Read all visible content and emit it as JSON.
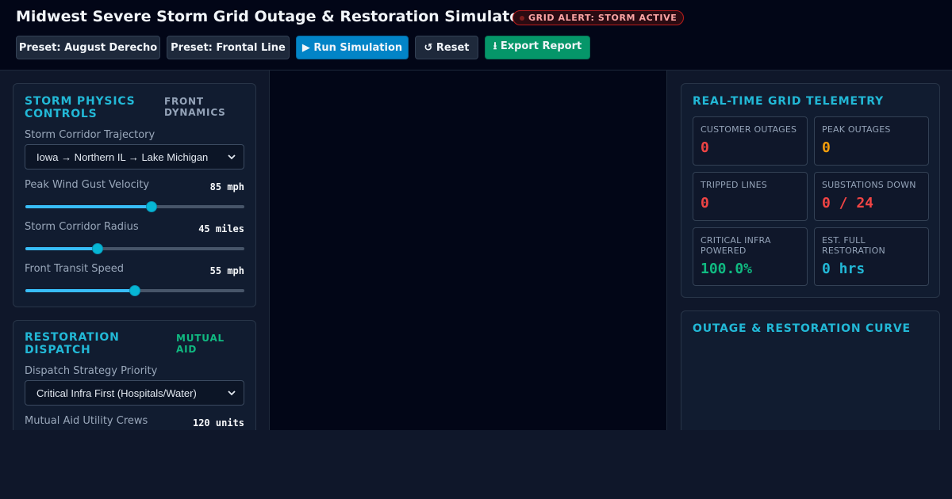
{
  "header": {
    "title": "Midwest Severe Storm Grid Outage & Restoration Simulator",
    "alert": "GRID ALERT: STORM ACTIVE",
    "buttons": {
      "preset_derecho": "Preset: August Derecho",
      "preset_frontal": "Preset: Frontal Line",
      "run": "▶ Run Simulation",
      "reset": "↺ Reset",
      "export": "⭳ Export Report"
    }
  },
  "storm_panel": {
    "title": "STORM PHYSICS CONTROLS",
    "tag": "FRONT DYNAMICS",
    "trajectory_label": "Storm Corridor Trajectory",
    "trajectory_value": "Iowa → Northern IL → Lake Michigan",
    "wind_label": "Peak Wind Gust Velocity",
    "wind_value": "85 mph",
    "wind_fraction": 0.58,
    "radius_label": "Storm Corridor Radius",
    "radius_value": "45 miles",
    "radius_fraction": 0.32,
    "speed_label": "Front Transit Speed",
    "speed_value": "55 mph",
    "speed_fraction": 0.5
  },
  "dispatch_panel": {
    "title": "RESTORATION DISPATCH",
    "tag": "MUTUAL AID",
    "strategy_label": "Dispatch Strategy Priority",
    "strategy_value": "Critical Infra First (Hospitals/Water)",
    "crews_label": "Mutual Aid Utility Crews",
    "crews_value": "120 units"
  },
  "telemetry": {
    "title": "REAL-TIME GRID TELEMETRY",
    "metrics": [
      {
        "label": "CUSTOMER OUTAGES",
        "value": "0",
        "color": "#ef4444"
      },
      {
        "label": "PEAK OUTAGES",
        "value": "0",
        "color": "#f59e0b"
      },
      {
        "label": "TRIPPED LINES",
        "value": "0",
        "color": "#ef4444"
      },
      {
        "label": "SUBSTATIONS DOWN",
        "value": "0 / 24",
        "color": "#ef4444"
      },
      {
        "label": "CRITICAL INFRA POWERED",
        "value": "100.0%",
        "color": "#10b981"
      },
      {
        "label": "EST. FULL RESTORATION",
        "value": "0 hrs",
        "color": "#22b8d6"
      }
    ]
  },
  "curve_panel": {
    "title": "OUTAGE & RESTORATION CURVE"
  },
  "colors": {
    "accent": "#22b8d6",
    "tag_front": "#94a3b8",
    "tag_aid": "#10b981",
    "alert": "#fca5a5"
  }
}
